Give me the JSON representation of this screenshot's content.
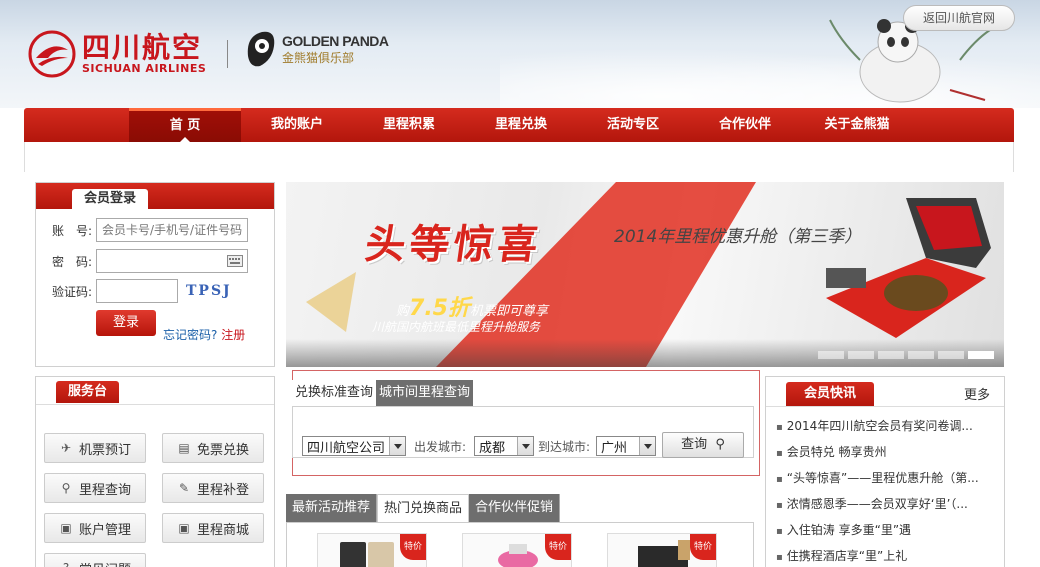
{
  "header": {
    "airline_cn": "四川航空",
    "airline_en": "SICHUAN AIRLINES",
    "club_en": "GOLDEN PANDA",
    "club_cn": "金熊猫俱乐部",
    "back_link": "返回川航官网"
  },
  "nav": {
    "items": [
      "首 页",
      "我的账户",
      "里程积累",
      "里程兑换",
      "活动专区",
      "合作伙伴",
      "关于金熊猫"
    ]
  },
  "login": {
    "title": "会员登录",
    "account_label": "账　号:",
    "account_placeholder": "会员卡号/手机号/证件号码",
    "password_label": "密　码:",
    "captcha_label": "验证码:",
    "captcha_text": "TPSJ",
    "submit": "登录",
    "forgot": "忘记密码?",
    "register": "注册"
  },
  "service": {
    "title": "服务台",
    "buttons": [
      "机票预订",
      "免票兑换",
      "里程查询",
      "里程补登",
      "账户管理",
      "里程商城",
      "常见问题"
    ]
  },
  "banner": {
    "headline": "头等惊喜",
    "subtitle": "2014年里程优惠升舱（第三季）",
    "line1_pre": "购",
    "line1_big": "7.5折",
    "line1_post": "机票即可尊享",
    "line2": "川航国内航班最低里程升舱服务"
  },
  "query": {
    "tab_active": "兑换标准查询",
    "tab_other": "城市间里程查询",
    "airline_value": "四川航空公司",
    "from_label": "出发城市:",
    "from_value": "成都",
    "to_label": "到达城市:",
    "to_value": "广州",
    "search": "查询"
  },
  "promo": {
    "tabs": [
      "最新活动推荐",
      "热门兑换商品",
      "合作伙伴促销"
    ],
    "badge": "特价"
  },
  "news": {
    "title": "会员快讯",
    "more": "更多",
    "items": [
      "2014年四川航空会员有奖问卷调...",
      "会员特兑  畅享贵州",
      "“头等惊喜”——里程优惠升舱（第...",
      "浓情感恩季——会员双享好‘里’（...",
      "入住铂涛 享多重“里”遇",
      "住携程酒店享“里”上礼"
    ]
  },
  "colors": {
    "brand_red": "#c8161d",
    "nav_red": "#d52b1e"
  }
}
